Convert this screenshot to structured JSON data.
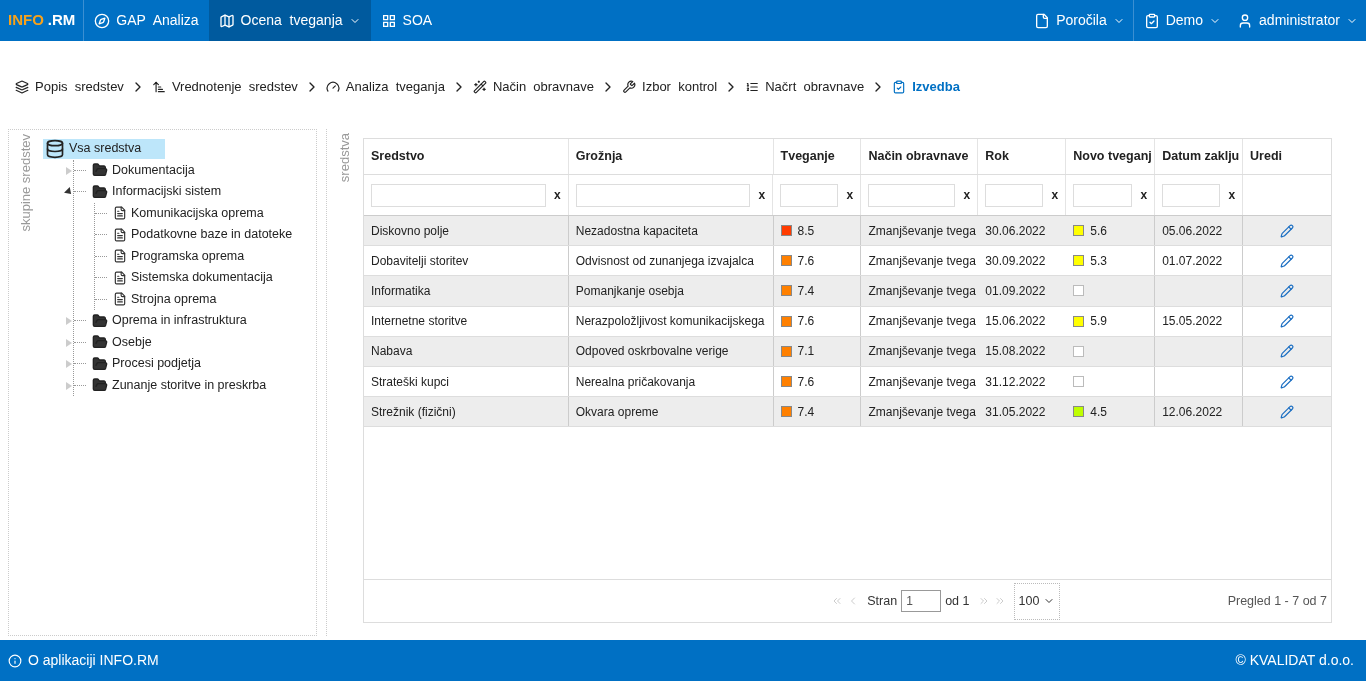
{
  "logo": {
    "part_1": "INFO",
    "part_2": ".RM"
  },
  "nav_left": [
    {
      "label": "GAP  Analiza",
      "selected": false,
      "dropdown": false
    },
    {
      "label": "Ocena  tveganja",
      "selected": true,
      "dropdown": true
    },
    {
      "label": "SOA",
      "selected": false,
      "dropdown": false
    }
  ],
  "nav_right": [
    {
      "label": "Poročila",
      "dropdown": true
    },
    {
      "label": "Demo",
      "dropdown": true
    },
    {
      "label": "administrator",
      "dropdown": true
    }
  ],
  "breadcrumbs": [
    {
      "label": "Popis  sredstev",
      "selected": false
    },
    {
      "label": "Vrednotenje  sredstev",
      "selected": false
    },
    {
      "label": "Analiza  tveganja",
      "selected": false
    },
    {
      "label": "Način  obravnave",
      "selected": false
    },
    {
      "label": "Izbor  kontrol",
      "selected": false
    },
    {
      "label": "Načrt  obravnave",
      "selected": false
    },
    {
      "label": "Izvedba",
      "selected": true
    }
  ],
  "groups_panel": {
    "title": "skupine sredstev",
    "tree": [
      {
        "label": "Vsa sredstva",
        "kind": "root",
        "selected": true,
        "children": [
          {
            "label": "Dokumentacija",
            "kind": "folder",
            "selected": false,
            "expanded": false
          },
          {
            "label": "Informacijski sistem",
            "kind": "folder",
            "selected": false,
            "expanded": true,
            "children": [
              {
                "label": "Komunikacijska oprema",
                "kind": "document",
                "selected": false
              },
              {
                "label": "Podatkovne baze in datoteke",
                "kind": "document",
                "selected": false
              },
              {
                "label": "Programska oprema",
                "kind": "document",
                "selected": false
              },
              {
                "label": "Sistemska dokumentacija",
                "kind": "document",
                "selected": false
              },
              {
                "label": "Strojna oprema",
                "kind": "document",
                "selected": false
              }
            ]
          },
          {
            "label": "Oprema in infrastruktura",
            "kind": "folder",
            "selected": false,
            "expanded": false
          },
          {
            "label": "Osebje",
            "kind": "folder",
            "selected": false,
            "expanded": false
          },
          {
            "label": "Procesi podjetja",
            "kind": "folder",
            "selected": false,
            "expanded": false
          },
          {
            "label": "Zunanje storitve in preskrba",
            "kind": "folder",
            "selected": false,
            "expanded": false
          }
        ]
      }
    ]
  },
  "assets_panel": {
    "title": "sredstva",
    "table": {
      "columns": [
        {
          "label": "Sredstvo",
          "filter_clear": "x"
        },
        {
          "label": "Grožnja",
          "filter_clear": "x"
        },
        {
          "label": "Tveganje",
          "filter_clear": "x"
        },
        {
          "label": "Način obravnave",
          "filter_clear": "x"
        },
        {
          "label": "Rok",
          "filter_clear": "x"
        },
        {
          "label": "Novo tveganj",
          "filter_clear": "x"
        },
        {
          "label": "Datum zaklju",
          "filter_clear": "x"
        },
        {
          "label": "Uredi"
        }
      ],
      "rows": [
        {
          "asset": "Diskovno polje",
          "threat": "Nezadostna kapaciteta",
          "risk": {
            "value": "8.5",
            "color": "#ff3c00"
          },
          "treatment": "Zmanjševanje tvega",
          "deadline": "30.06.2022",
          "new_risk": {
            "value": "5.6",
            "color": "#ffff00"
          },
          "closed": "05.06.2022"
        },
        {
          "asset": "Dobavitelji storitev",
          "threat": "Odvisnost od zunanjega izvajalca",
          "risk": {
            "value": "7.6",
            "color": "#ff8000"
          },
          "treatment": "Zmanjševanje tvega",
          "deadline": "30.09.2022",
          "new_risk": {
            "value": "5.3",
            "color": "#ffff00"
          },
          "closed": "01.07.2022"
        },
        {
          "asset": "Informatika",
          "threat": "Pomanjkanje osebja",
          "risk": {
            "value": "7.4",
            "color": "#ff8000"
          },
          "treatment": "Zmanjševanje tvega",
          "deadline": "01.09.2022",
          "new_risk": null,
          "closed": null
        },
        {
          "asset": "Internetne storitve",
          "threat": "Nerazpoložljivost komunikacijskega",
          "risk": {
            "value": "7.6",
            "color": "#ff8000"
          },
          "treatment": "Zmanjševanje tvega",
          "deadline": "15.06.2022",
          "new_risk": {
            "value": "5.9",
            "color": "#ffff00"
          },
          "closed": "15.05.2022"
        },
        {
          "asset": "Nabava",
          "threat": "Odpoved oskrbovalne verige",
          "risk": {
            "value": "7.1",
            "color": "#ff8000"
          },
          "treatment": "Zmanjševanje tvega",
          "deadline": "15.08.2022",
          "new_risk": null,
          "closed": null
        },
        {
          "asset": "Strateški kupci",
          "threat": "Nerealna pričakovanja",
          "risk": {
            "value": "7.6",
            "color": "#ff8000"
          },
          "treatment": "Zmanjševanje tvega",
          "deadline": "31.12.2022",
          "new_risk": null,
          "closed": null
        },
        {
          "asset": "Strežnik (fizični)",
          "threat": "Okvara opreme",
          "risk": {
            "value": "7.4",
            "color": "#ff8000"
          },
          "treatment": "Zmanjševanje tvega",
          "deadline": "31.05.2022",
          "new_risk": {
            "value": "4.5",
            "color": "#bfff00"
          },
          "closed": "12.06.2022"
        }
      ]
    },
    "pager": {
      "page_label": "Stran",
      "page_value": "1",
      "of_pages": "od 1",
      "page_size": "100",
      "summary": "Pregled 1 - 7 od 7"
    }
  },
  "footer": {
    "about": "O aplikaciji INFO.RM",
    "copyright": "© KVALIDAT d.o.o."
  }
}
